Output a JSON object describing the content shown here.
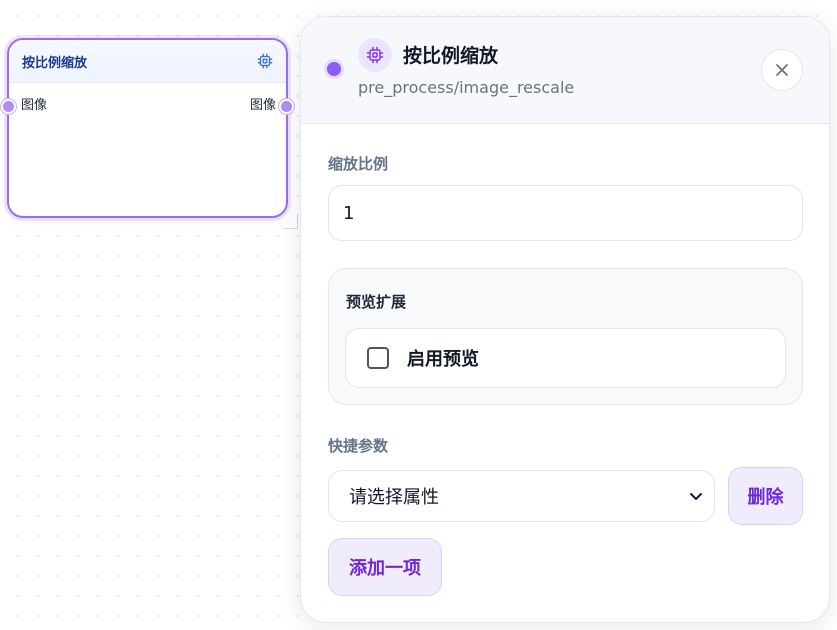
{
  "node": {
    "title": "按比例缩放",
    "icon": "chip-icon",
    "input_port": "图像",
    "output_port": "图像"
  },
  "panel": {
    "title": "按比例缩放",
    "path": "pre_process/image_rescale",
    "icon": "chip-icon",
    "close_icon": "close-icon",
    "scale": {
      "label": "缩放比例",
      "value": "1"
    },
    "preview": {
      "title": "预览扩展",
      "checkbox_label": "启用预览",
      "checked": false
    },
    "shortcut": {
      "label": "快捷参数",
      "select_placeholder": "请选择属性",
      "delete_label": "删除",
      "add_label": "添加一项"
    }
  },
  "colors": {
    "accent": "#8b5cf6",
    "accent_text": "#6d28d9",
    "node_title": "#1e3a8a",
    "soft_button_bg": "#f1ebfe"
  }
}
